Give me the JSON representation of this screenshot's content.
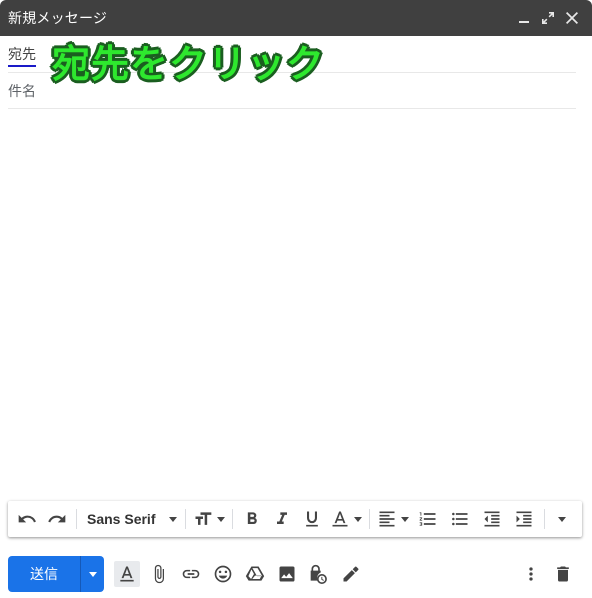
{
  "window": {
    "title": "新規メッセージ"
  },
  "fields": {
    "to_label": "宛先",
    "subject_label": "件名"
  },
  "overlay": {
    "caption": "宛先をクリック"
  },
  "toolbar": {
    "font_family": "Sans Serif"
  },
  "actions": {
    "send_label": "送信"
  },
  "colors": {
    "titlebar": "#404040",
    "send_button": "#1a73e8",
    "caption_fill": "#2ee82e",
    "caption_outline": "#1b5e20",
    "to_underline": "#1a1ac8"
  }
}
